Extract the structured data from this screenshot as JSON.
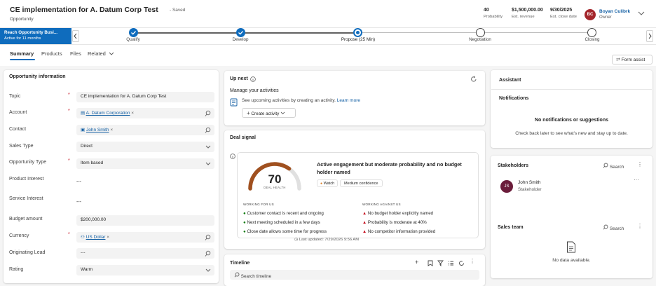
{
  "header": {
    "title": "CE implementation for A. Datum Corp Test",
    "saved": "- Saved",
    "entity": "Opportunity",
    "kpis": [
      {
        "value": "40",
        "label": "Probability"
      },
      {
        "value": "$1,500,000.00",
        "label": "Est. revenue"
      },
      {
        "value": "9/30/2025",
        "label": "Est. close date"
      }
    ],
    "owner": {
      "initials": "BC",
      "name": "Boyan Culibrk",
      "role": "Owner"
    }
  },
  "process": {
    "flag_title": "Reach Opportunity Busi...",
    "flag_sub": "Active for 11 months",
    "stages": [
      {
        "label": "Qualify",
        "state": "done"
      },
      {
        "label": "Develop",
        "state": "done"
      },
      {
        "label": "Propose  (25 Min)",
        "state": "active"
      },
      {
        "label": "Negotiation",
        "state": "pending"
      },
      {
        "label": "Closing",
        "state": "pending"
      }
    ]
  },
  "tabs": {
    "items": [
      "Summary",
      "Products",
      "Files",
      "Related"
    ],
    "form_assist": "Form assist"
  },
  "opp": {
    "title": "Opportunity information",
    "fields": [
      {
        "label": "Topic",
        "required": true,
        "value": "CE implementation for A. Datum Corp Test"
      },
      {
        "label": "Account",
        "required": true,
        "value": "A. Datum Corporation"
      },
      {
        "label": "Contact",
        "required": false,
        "value": "John Smith"
      },
      {
        "label": "Sales Type",
        "required": false,
        "value": "Direct"
      },
      {
        "label": "Opportunity Type",
        "required": true,
        "value": "Item based"
      },
      {
        "label": "Product Interest",
        "required": false,
        "value": "---"
      },
      {
        "label": "Service Interest",
        "required": false,
        "value": "---"
      },
      {
        "label": "Budget amount",
        "required": false,
        "value": "$200,000.00"
      },
      {
        "label": "Currency",
        "required": true,
        "value": "US Dollar"
      },
      {
        "label": "Originating Lead",
        "required": false,
        "value": "---"
      },
      {
        "label": "Rating",
        "required": false,
        "value": "Warm"
      }
    ]
  },
  "upnext": {
    "title": "Up next",
    "manage": "Manage your activities",
    "desc": "See upcoming activities by creating an activity.",
    "learn": "Learn more",
    "create": "Create activity"
  },
  "deal": {
    "title": "Deal signal",
    "score": "70",
    "score_label": "DEAL HEALTH",
    "score_fraction": 0.7,
    "headline": "Active engagement but moderate probability and no budget holder named",
    "tag1": "Watch",
    "tag2": "Medium confidence",
    "for_title": "WORKING FOR US",
    "against_title": "WORKING AGAINST US",
    "for_items": [
      "Customer contact is recent and ongoing",
      "Next meeting scheduled in a few days",
      "Close date allows some time for progress"
    ],
    "against_items": [
      "No budget holder explicitly named",
      "Probability is moderate at 40%",
      "No competitor information provided"
    ],
    "updated": "Last updated: 7/29/2026 9:56 AM"
  },
  "timeline": {
    "title": "Timeline",
    "search": "Search timeline"
  },
  "assistant": {
    "title": "Assistant",
    "notif_title": "Notifications",
    "empty_title": "No notifications or suggestions",
    "empty_sub": "Check back later to see what's new and stay up to date."
  },
  "stakeholders": {
    "title": "Stakeholders",
    "search": "Search",
    "person": {
      "initials": "JS",
      "name": "John Smith",
      "role": "Stakeholder"
    }
  },
  "salesteam": {
    "title": "Sales team",
    "search": "Search",
    "empty": "No data available."
  },
  "colors": {
    "accent": "#0f6cbd",
    "owner_avatar": "#a4262c",
    "stakeholder_avatar": "#6b1d3b",
    "gauge": "#a0501f",
    "green": "#107c10",
    "red": "#c50f1f"
  }
}
